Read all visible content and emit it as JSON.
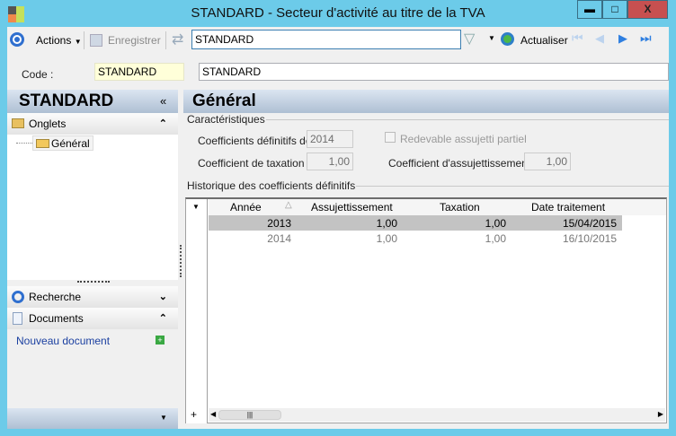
{
  "window": {
    "title": "STANDARD -  Secteur d'activité au titre de la TVA",
    "minimize": "▬",
    "maximize": "□",
    "close": "X"
  },
  "toolbar": {
    "actions_label": "Actions",
    "save_label": "Enregistrer",
    "search_value": "STANDARD",
    "refresh_label": "Actualiser"
  },
  "code": {
    "label": "Code :",
    "value": "STANDARD",
    "description": "STANDARD"
  },
  "sidebar": {
    "title": "STANDARD",
    "collapse": "«",
    "onglets_label": "Onglets",
    "tree_item": "Général",
    "recherche_label": "Recherche",
    "documents_label": "Documents",
    "new_document": "Nouveau document"
  },
  "main": {
    "title": "Général",
    "caracteristiques": {
      "legend": "Caractéristiques",
      "coef_def_label": "Coefficients définitifs de :",
      "coef_def_value": "2014",
      "redevable_label": "Redevable assujetti partiel",
      "redevable_checked": false,
      "taxation_label": "Coefficient de taxation :",
      "taxation_value": "1,00",
      "assuj_label": "Coefficient d'assujettissement :",
      "assuj_value": "1,00"
    },
    "historique": {
      "legend": "Historique des coefficients définitifs",
      "columns": [
        "Année",
        "Assujettissement",
        "Taxation",
        "Date traitement"
      ],
      "rows": [
        [
          "2013",
          "1,00",
          "1,00",
          "15/04/2015"
        ],
        [
          "2014",
          "1,00",
          "1,00",
          "16/10/2015"
        ]
      ]
    }
  }
}
